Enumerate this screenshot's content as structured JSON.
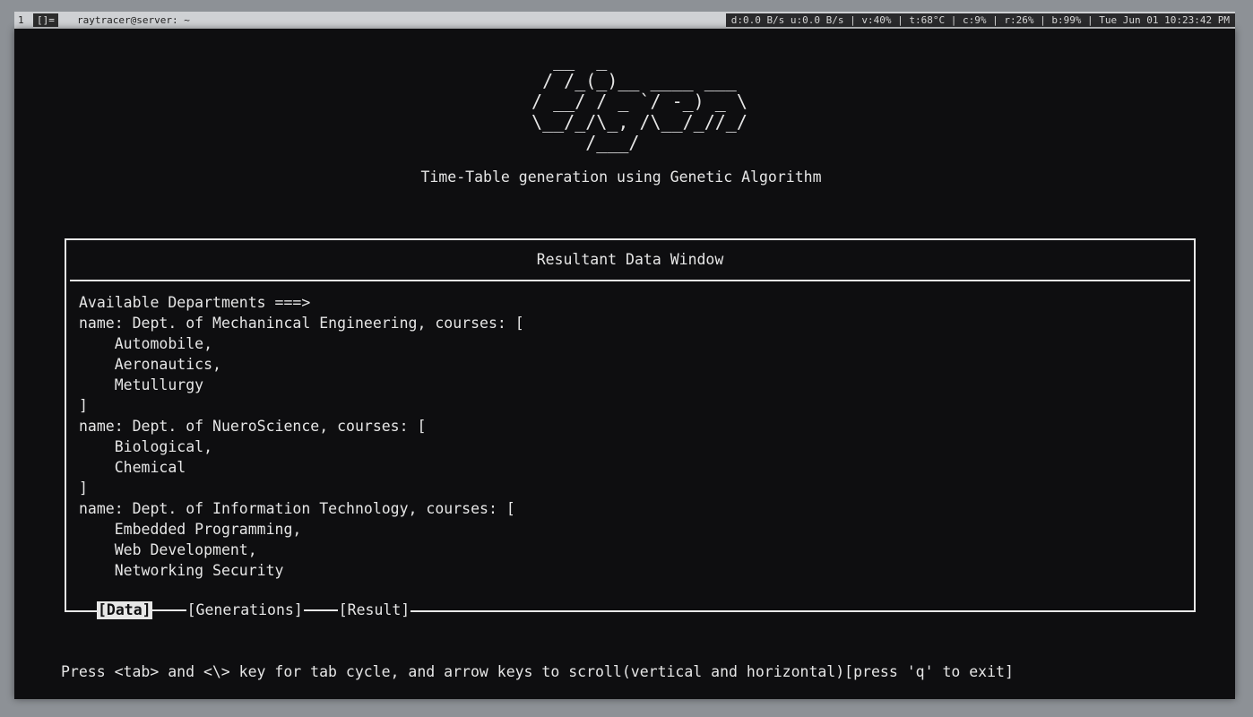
{
  "topbar": {
    "workspace": "1",
    "layout_indicator": "[]=",
    "window_title": "raytracer@server: ~",
    "status": "d:0.0 B/s u:0.0 B/s | v:40% | t:68°C | c:9% | r:26% | b:99% | Tue Jun 01 10:23:42 PM"
  },
  "app": {
    "ascii_logo": "   __  _\n  / /_(_)__ ____ ___\n / __/ / _ `/ -_) _ \\\n \\__/_/\\_, /\\__/_//_/\n      /___/",
    "subtitle": "Time-Table generation using Genetic Algorithm"
  },
  "panel": {
    "title": "Resultant Data Window",
    "lines": [
      "Available Departments ===>",
      "name: Dept. of Mechanincal Engineering, courses: [",
      "    Automobile,",
      "    Aeronautics,",
      "    Metullurgy",
      "]",
      "name: Dept. of NueroScience, courses: [",
      "    Biological,",
      "    Chemical",
      "]",
      "name: Dept. of Information Technology, courses: [",
      "    Embedded Programming,",
      "    Web Development,",
      "    Networking Security"
    ]
  },
  "tabs": [
    {
      "label": "[Data]",
      "active": true
    },
    {
      "label": "[Generations]",
      "active": false
    },
    {
      "label": "[Result]",
      "active": false
    }
  ],
  "footer": {
    "help": "Press <tab> and <\\> key for tab cycle, and arrow keys to scroll(vertical and horizontal)[press 'q' to exit]"
  },
  "colors": {
    "terminal_bg": "#0e0e10",
    "text": "#e6e6e6",
    "desktop_bg": "#8d9196",
    "bar_bg": "#cfd1d4"
  }
}
